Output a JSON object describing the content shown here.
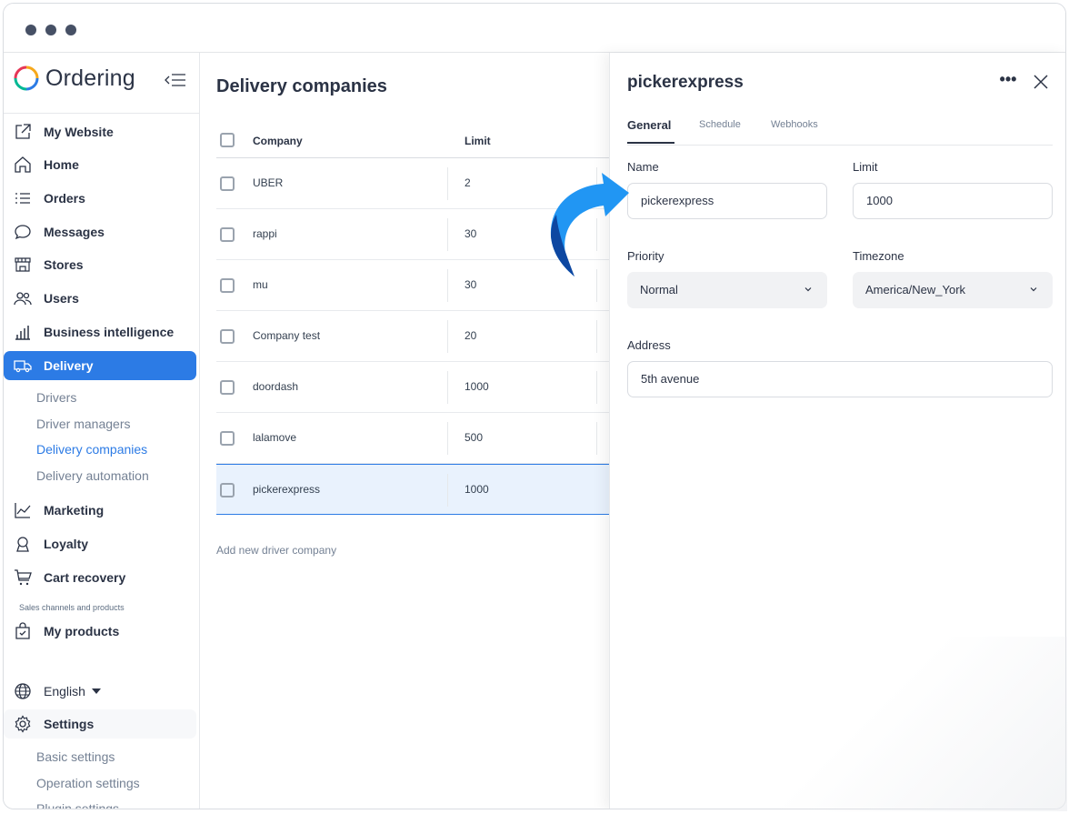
{
  "app": {
    "logo_text": "Ordering"
  },
  "sidebar": {
    "items": [
      {
        "label": "My Website",
        "icon": "external-link-icon"
      },
      {
        "label": "Home",
        "icon": "home-icon"
      },
      {
        "label": "Orders",
        "icon": "list-icon"
      },
      {
        "label": "Messages",
        "icon": "chat-icon"
      },
      {
        "label": "Stores",
        "icon": "store-icon"
      },
      {
        "label": "Users",
        "icon": "users-icon"
      },
      {
        "label": "Business intelligence",
        "icon": "bar-chart-icon"
      },
      {
        "label": "Delivery",
        "icon": "truck-icon"
      },
      {
        "label": "Marketing",
        "icon": "trend-icon"
      },
      {
        "label": "Loyalty",
        "icon": "award-icon"
      },
      {
        "label": "Cart recovery",
        "icon": "cart-icon"
      },
      {
        "label": "My products",
        "icon": "bag-icon"
      },
      {
        "label": "English",
        "icon": "globe-icon"
      },
      {
        "label": "Settings",
        "icon": "gear-icon"
      }
    ],
    "delivery_sub": [
      "Drivers",
      "Driver managers",
      "Delivery companies",
      "Delivery automation"
    ],
    "section_caption": "Sales channels and products",
    "settings_sub": [
      "Basic settings",
      "Operation settings",
      "Plugin settings"
    ]
  },
  "main": {
    "title": "Delivery companies",
    "columns": [
      "Company",
      "Limit"
    ],
    "rows": [
      {
        "company": "UBER",
        "limit": "2"
      },
      {
        "company": "rappi",
        "limit": "30"
      },
      {
        "company": "mu",
        "limit": "30"
      },
      {
        "company": "Company test",
        "limit": "20"
      },
      {
        "company": "doordash",
        "limit": "1000"
      },
      {
        "company": "lalamove",
        "limit": "500"
      },
      {
        "company": "pickerexpress",
        "limit": "1000"
      }
    ],
    "add_link": "Add new driver company"
  },
  "panel": {
    "title": "pickerexpress",
    "more": "•••",
    "tabs": [
      "General",
      "Schedule",
      "Webhooks"
    ],
    "fields": {
      "name_label": "Name",
      "name_value": "pickerexpress",
      "limit_label": "Limit",
      "limit_value": "1000",
      "priority_label": "Priority",
      "priority_value": "Normal",
      "timezone_label": "Timezone",
      "timezone_value": "America/New_York",
      "address_label": "Address",
      "address_value": "5th avenue"
    }
  },
  "colors": {
    "accent": "#2c7be5",
    "arrow": "#2196f3",
    "text": "#2b3345"
  }
}
